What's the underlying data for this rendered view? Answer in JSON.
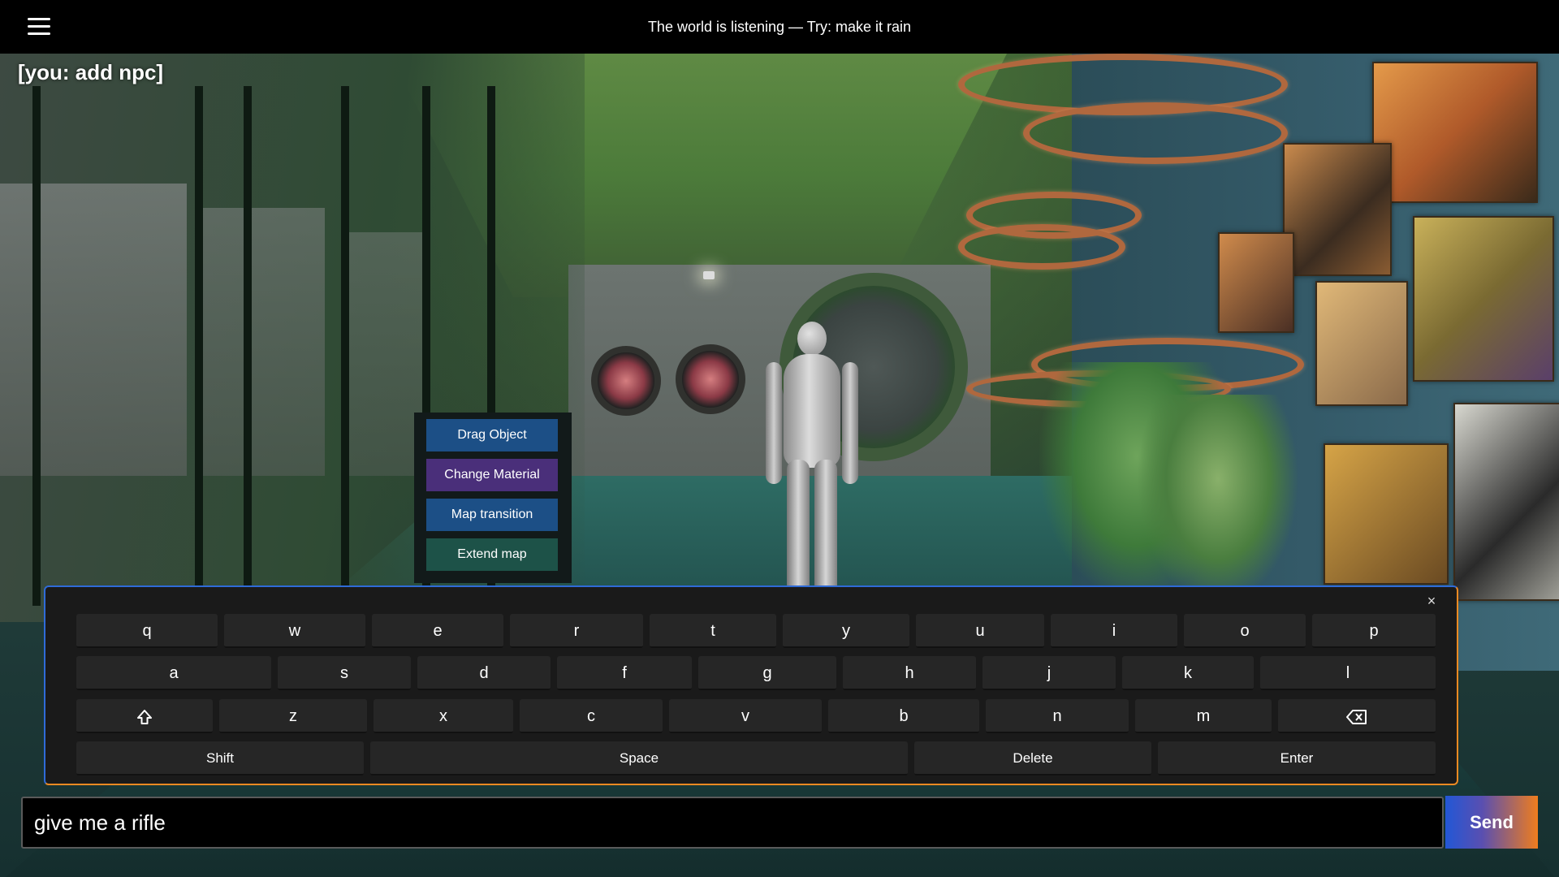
{
  "topbar": {
    "title": "The world is listening — Try: make it rain",
    "menu_icon": "hamburger-menu-icon"
  },
  "chat_log": {
    "last_message": "[you: add npc]"
  },
  "context_menu": {
    "items": [
      {
        "label": "Drag Object",
        "color": "#1c4f86"
      },
      {
        "label": "Change Material",
        "color": "#4a2f7a"
      },
      {
        "label": "Map transition",
        "color": "#1c4f86"
      },
      {
        "label": "Extend map",
        "color": "#1d5248"
      }
    ]
  },
  "keyboard": {
    "close_icon": "close-icon",
    "close_label": "×",
    "rows": [
      [
        "q",
        "w",
        "e",
        "r",
        "t",
        "y",
        "u",
        "i",
        "o",
        "p"
      ],
      [
        "a",
        "s",
        "d",
        "f",
        "g",
        "h",
        "j",
        "k",
        "l"
      ],
      [
        "shift-arrow-icon",
        "z",
        "x",
        "c",
        "v",
        "b",
        "n",
        "m",
        "backspace-icon"
      ],
      [
        "Shift",
        "Space",
        "Delete",
        "Enter"
      ]
    ],
    "border_colors": {
      "left": "#2f6bd8",
      "right": "#ef8a22"
    }
  },
  "input": {
    "value": "give me a rifle",
    "placeholder": ""
  },
  "send": {
    "label": "Send",
    "gradient": [
      "#2257d6",
      "#ef7d1e"
    ]
  }
}
